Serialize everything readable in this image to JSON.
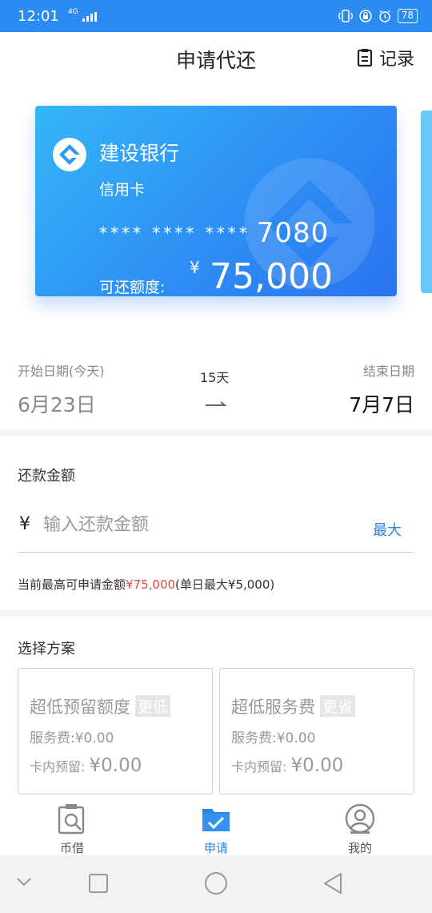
{
  "status": {
    "time": "12:01",
    "network": "4G",
    "battery": "78"
  },
  "header": {
    "title": "申请代还",
    "record_label": "记录"
  },
  "card": {
    "bank_name": "建设银行",
    "card_type": "信用卡",
    "masked_number": "**** **** ****",
    "last4": "7080",
    "limit_label": "可还额度:",
    "currency": "¥",
    "limit": "75,000"
  },
  "dates": {
    "start_label": "开始日期(今天)",
    "start_value": "6月23日",
    "duration": "15天",
    "end_label": "结束日期",
    "end_value": "7月7日"
  },
  "amount": {
    "label": "还款金额",
    "currency": "¥",
    "placeholder": "输入还款金额",
    "max_label": "最大",
    "hint_prefix": "当前最高可申请金额",
    "hint_amount": "¥75,000",
    "hint_suffix": "(单日最大¥5,000)"
  },
  "plans": {
    "label": "选择方案",
    "items": [
      {
        "name": "超低预留额度",
        "tag": "更低",
        "fee": "服务费:¥0.00",
        "reserve_label": "卡内预留:",
        "reserve_value": "¥0.00"
      },
      {
        "name": "超低服务费",
        "tag": "更省",
        "fee": "服务费:¥0.00",
        "reserve_label": "卡内预留:",
        "reserve_value": "¥0.00"
      }
    ]
  },
  "tabs": [
    {
      "label": "币借",
      "icon": "search-doc-icon"
    },
    {
      "label": "申请",
      "icon": "folder-check-icon",
      "active": true
    },
    {
      "label": "我的",
      "icon": "person-icon"
    }
  ],
  "colors": {
    "status_bar": "#2b8bf0",
    "accent": "#2a84e2",
    "highlight": "#e6483e"
  }
}
